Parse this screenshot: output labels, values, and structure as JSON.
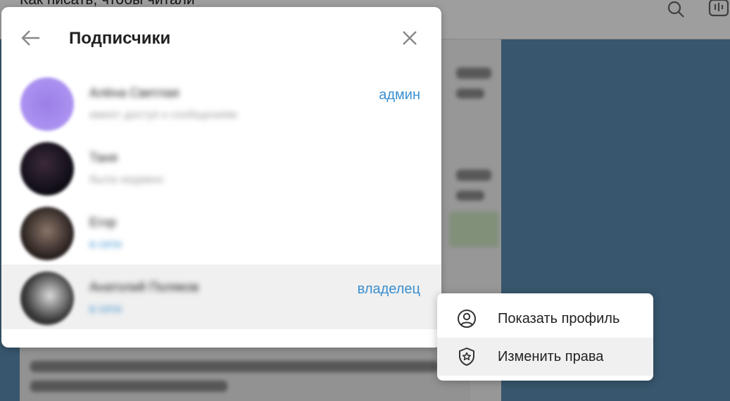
{
  "background": {
    "chat_title": "Как писать, чтобы читали"
  },
  "dialog": {
    "title": "Подписчики",
    "members": [
      {
        "name": "Алёна Светлая",
        "status": "имеет доступ к сообщениям",
        "role": "админ",
        "avatar_color": "#a78bfa"
      },
      {
        "name": "Таня",
        "status": "была недавно",
        "role": "",
        "avatar_color": "#1f1a2e"
      },
      {
        "name": "Егор",
        "status": "в сети",
        "role": "",
        "avatar_color": "#3a302b"
      },
      {
        "name": "Анатолий Поляков",
        "status": "в сети",
        "role": "владелец",
        "avatar_color": "#2b2b2b"
      }
    ]
  },
  "context_menu": {
    "items": [
      {
        "label": "Показать профиль",
        "icon": "profile-icon"
      },
      {
        "label": "Изменить права",
        "icon": "shield-star-icon"
      }
    ]
  },
  "colors": {
    "accent": "#3a8fd0",
    "side_panel": "#5b8bb0"
  }
}
